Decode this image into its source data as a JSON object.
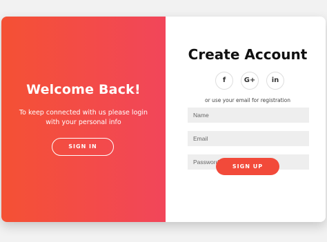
{
  "overlay": {
    "title": "Welcome Back!",
    "text": "To keep connected with us please login with your personal info",
    "signin_label": "SIGN IN"
  },
  "form": {
    "title": "Create Account",
    "socials": {
      "facebook": "f",
      "google": "G+",
      "linkedin": "in"
    },
    "hint": "or use your email for registration",
    "name_placeholder": "Name",
    "email_placeholder": "Email",
    "password_placeholder": "Password",
    "signup_label": "SIGN UP"
  },
  "colors": {
    "accent": "#f24a3a",
    "gradient_start": "#f45134",
    "gradient_end": "#f2465a"
  }
}
